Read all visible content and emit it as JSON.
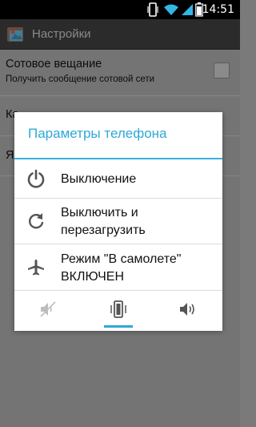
{
  "status_bar": {
    "time": "14:51",
    "icons": [
      "vibrate-icon",
      "wifi-icon",
      "signal-icon",
      "battery-icon"
    ]
  },
  "action_bar": {
    "title": "Настройки",
    "icon": "settings-app-icon"
  },
  "settings": {
    "rows": [
      {
        "title": "Сотовое вещание",
        "summary": "Получить сообщение сотовой сети",
        "checked": false
      },
      {
        "title": "Ка"
      },
      {
        "title": "Яз"
      }
    ]
  },
  "dialog": {
    "title": "Параметры телефона",
    "accent_color": "#2ea8d8",
    "options": [
      {
        "icon": "power-icon",
        "label": "Выключение"
      },
      {
        "icon": "restart-icon",
        "label_line1": "Выключить и",
        "label_line2": "перезагрузить"
      },
      {
        "icon": "airplane-icon",
        "label_line1": "Режим \"В самолете\"",
        "label_line2": "ВКЛЮЧЕН"
      }
    ],
    "sound_modes": [
      {
        "icon": "sound-off-icon",
        "selected": false
      },
      {
        "icon": "vibrate-mode-icon",
        "selected": true
      },
      {
        "icon": "sound-on-icon",
        "selected": false
      }
    ]
  }
}
